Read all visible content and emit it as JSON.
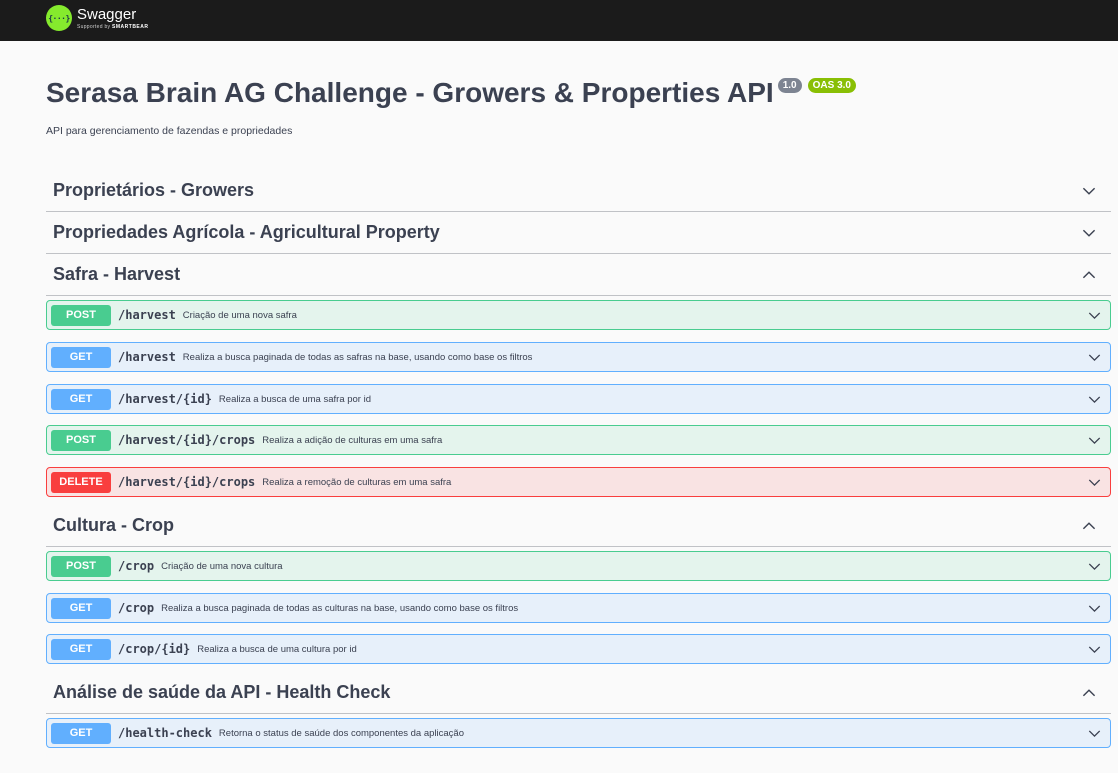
{
  "topbar": {
    "brand": "Swagger",
    "tagline_prefix": "Supported by",
    "tagline_company": "SMARTBEAR",
    "logo_glyph": "{···}",
    "logo_color": "#85ea2d"
  },
  "info": {
    "title": "Serasa Brain AG Challenge - Growers & Properties API",
    "version": "1.0",
    "oas": "OAS 3.0",
    "description": "API para gerenciamento de fazendas e propriedades"
  },
  "tags": [
    {
      "label": "Proprietários - Growers",
      "expanded": false
    },
    {
      "label": "Propriedades Agrícola - Agricultural Property",
      "expanded": false
    },
    {
      "label": "Safra - Harvest",
      "expanded": true
    },
    {
      "label": "Cultura - Crop",
      "expanded": true
    },
    {
      "label": "Análise de saúde da API - Health Check",
      "expanded": true
    }
  ],
  "operations": [
    {
      "method": "POST",
      "path": "/harvest",
      "summary": "Criação de uma nova safra"
    },
    {
      "method": "GET",
      "path": "/harvest",
      "summary": "Realiza a busca paginada de todas as safras na base, usando como base os filtros"
    },
    {
      "method": "GET",
      "path": "/harvest/{id}",
      "summary": "Realiza a busca de uma safra por id"
    },
    {
      "method": "POST",
      "path": "/harvest/{id}/crops",
      "summary": "Realiza a adição de culturas em uma safra"
    },
    {
      "method": "DELETE",
      "path": "/harvest/{id}/crops",
      "summary": "Realiza a remoção de culturas em uma safra"
    },
    {
      "method": "POST",
      "path": "/crop",
      "summary": "Criação de uma nova cultura"
    },
    {
      "method": "GET",
      "path": "/crop",
      "summary": "Realiza a busca paginada de todas as culturas na base, usando como base os filtros"
    },
    {
      "method": "GET",
      "path": "/crop/{id}",
      "summary": "Realiza a busca de uma cultura por id"
    },
    {
      "method": "GET",
      "path": "/health-check",
      "summary": "Retorna o status de saúde dos componentes da aplicação"
    }
  ],
  "colors": {
    "post": "#49cc90",
    "get": "#61affe",
    "delete": "#f93e3e"
  }
}
